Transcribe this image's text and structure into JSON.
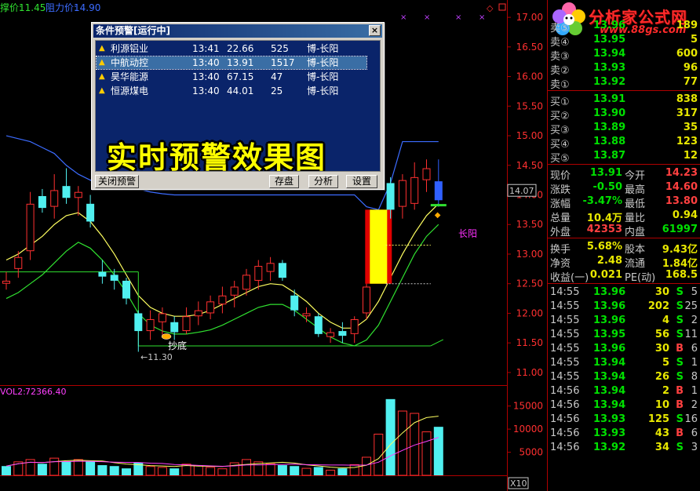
{
  "header": {
    "support_label": "撑价:",
    "support_value": "11.45",
    "resist_label": "阻力价:",
    "resist_value": "14.90"
  },
  "volume_header": {
    "label": "VOL2:",
    "value": "72366.40"
  },
  "volume_axis": [
    "15000",
    "10000",
    "5000"
  ],
  "zoom": "X10",
  "annotations": {
    "buy_bottom": "抄底",
    "low_marker": "←11.30",
    "long_yang": "长阳",
    "current_price_box": "14.07"
  },
  "price_axis": [
    "17.00",
    "16.50",
    "16.00",
    "15.50",
    "15.00",
    "14.50",
    "14.00",
    "13.50",
    "13.00",
    "12.50",
    "12.00",
    "11.50",
    "11.00"
  ],
  "dialog": {
    "title": "条件预警[运行中]",
    "close": "×",
    "rows": [
      {
        "name": "利源铝业",
        "time": "13:41",
        "price": "22.66",
        "vol": "525",
        "note": "博-长阳"
      },
      {
        "name": "中航动控",
        "time": "13:40",
        "price": "13.91",
        "vol": "1517",
        "note": "博-长阳"
      },
      {
        "name": "昊华能源",
        "time": "13:40",
        "price": "67.15",
        "vol": "47",
        "note": "博-长阳"
      },
      {
        "name": "恒源煤电",
        "time": "13:40",
        "price": "44.01",
        "vol": "25",
        "note": "博-长阳"
      }
    ],
    "banner": "实时预警效果图",
    "buttons": {
      "close_alert": "关闭预警",
      "save": "存盘",
      "analyze": "分析",
      "settings": "设置"
    }
  },
  "logo": {
    "name": "分析家公式网",
    "url": "www.88gs.com"
  },
  "orderbook": {
    "sells": [
      {
        "label": "卖⑤",
        "price": "13.96",
        "qty": "189"
      },
      {
        "label": "卖④",
        "price": "13.95",
        "qty": "5"
      },
      {
        "label": "卖③",
        "price": "13.94",
        "qty": "600"
      },
      {
        "label": "卖②",
        "price": "13.93",
        "qty": "96"
      },
      {
        "label": "卖①",
        "price": "13.92",
        "qty": "77"
      }
    ],
    "buys": [
      {
        "label": "买①",
        "price": "13.91",
        "qty": "838"
      },
      {
        "label": "买②",
        "price": "13.90",
        "qty": "317"
      },
      {
        "label": "买③",
        "price": "13.89",
        "qty": "35"
      },
      {
        "label": "买④",
        "price": "13.88",
        "qty": "123"
      },
      {
        "label": "买⑤",
        "price": "13.87",
        "qty": "12"
      }
    ]
  },
  "stats": [
    {
      "l1": "现价",
      "v1": "13.91",
      "c1": "green",
      "l2": "今开",
      "v2": "14.23",
      "c2": "red"
    },
    {
      "l1": "涨跌",
      "v1": "-0.50",
      "c1": "green",
      "l2": "最高",
      "v2": "14.60",
      "c2": "red"
    },
    {
      "l1": "涨幅",
      "v1": "-3.47%",
      "c1": "green",
      "l2": "最低",
      "v2": "13.80",
      "c2": "red"
    },
    {
      "l1": "总量",
      "v1": "10.4万",
      "c1": "yellow",
      "l2": "量比",
      "v2": "0.94",
      "c2": "yellow"
    },
    {
      "l1": "外盘",
      "v1": "42353",
      "c1": "red",
      "l2": "内盘",
      "v2": "61997",
      "c2": "green"
    }
  ],
  "stats2": [
    {
      "l1": "换手",
      "v1": "5.68%",
      "l2": "股本",
      "v2": "9.43亿"
    },
    {
      "l1": "净资",
      "v1": "2.48",
      "l2": "流通",
      "v2": "1.84亿"
    },
    {
      "l1": "收益(一)",
      "v1": "0.021",
      "l2": "PE(动)",
      "v2": "168.5"
    }
  ],
  "ticks": [
    {
      "time": "14:55",
      "price": "13.96",
      "vol": "30",
      "side": "S",
      "n": "5"
    },
    {
      "time": "14:55",
      "price": "13.96",
      "vol": "202",
      "side": "S",
      "n": "25"
    },
    {
      "time": "14:55",
      "price": "13.96",
      "vol": "4",
      "side": "S",
      "n": "2"
    },
    {
      "time": "14:55",
      "price": "13.95",
      "vol": "56",
      "side": "S",
      "n": "11"
    },
    {
      "time": "14:55",
      "price": "13.96",
      "vol": "30",
      "side": "B",
      "n": "6"
    },
    {
      "time": "14:55",
      "price": "13.94",
      "vol": "5",
      "side": "S",
      "n": "1"
    },
    {
      "time": "14:55",
      "price": "13.94",
      "vol": "26",
      "side": "S",
      "n": "8"
    },
    {
      "time": "14:56",
      "price": "13.94",
      "vol": "2",
      "side": "B",
      "n": "1"
    },
    {
      "time": "14:56",
      "price": "13.94",
      "vol": "10",
      "side": "B",
      "n": "2"
    },
    {
      "time": "14:56",
      "price": "13.93",
      "vol": "125",
      "side": "S",
      "n": "16"
    },
    {
      "time": "14:56",
      "price": "13.93",
      "vol": "43",
      "side": "B",
      "n": "6"
    },
    {
      "time": "14:56",
      "price": "13.92",
      "vol": "34",
      "side": "S",
      "n": "3"
    }
  ],
  "chart_data": {
    "type": "candlestick",
    "ylim": [
      10.8,
      17.2
    ],
    "candles": [
      {
        "o": 12.55,
        "h": 12.7,
        "l": 12.4,
        "c": 12.5,
        "color": "red"
      },
      {
        "o": 12.75,
        "h": 13.05,
        "l": 12.6,
        "c": 12.95,
        "color": "red"
      },
      {
        "o": 13.05,
        "h": 14.05,
        "l": 12.9,
        "c": 13.85,
        "color": "red"
      },
      {
        "o": 13.98,
        "h": 14.1,
        "l": 13.7,
        "c": 13.78,
        "color": "cyan"
      },
      {
        "o": 13.8,
        "h": 14.35,
        "l": 13.6,
        "c": 14.08,
        "color": "red"
      },
      {
        "o": 14.15,
        "h": 14.45,
        "l": 13.85,
        "c": 13.95,
        "color": "cyan"
      },
      {
        "o": 13.95,
        "h": 14.15,
        "l": 13.65,
        "c": 14.05,
        "color": "red"
      },
      {
        "o": 13.85,
        "h": 14.0,
        "l": 13.45,
        "c": 13.55,
        "color": "cyan"
      },
      {
        "o": 12.7,
        "h": 12.9,
        "l": 12.5,
        "c": 12.62,
        "color": "cyan"
      },
      {
        "o": 12.65,
        "h": 12.75,
        "l": 12.4,
        "c": 12.55,
        "color": "cyan"
      },
      {
        "o": 12.55,
        "h": 12.6,
        "l": 12.15,
        "c": 12.25,
        "color": "cyan"
      },
      {
        "o": 12.0,
        "h": 12.05,
        "l": 11.35,
        "c": 11.7,
        "color": "cyan"
      },
      {
        "o": 11.7,
        "h": 12.05,
        "l": 11.55,
        "c": 11.9,
        "color": "red"
      },
      {
        "o": 11.85,
        "h": 12.1,
        "l": 11.6,
        "c": 12.0,
        "color": "red"
      },
      {
        "o": 11.85,
        "h": 11.95,
        "l": 11.55,
        "c": 11.68,
        "color": "cyan"
      },
      {
        "o": 11.7,
        "h": 12.1,
        "l": 11.65,
        "c": 11.95,
        "color": "red"
      },
      {
        "o": 11.95,
        "h": 12.2,
        "l": 11.8,
        "c": 12.05,
        "color": "red"
      },
      {
        "o": 12.0,
        "h": 12.3,
        "l": 11.9,
        "c": 12.2,
        "color": "red"
      },
      {
        "o": 12.15,
        "h": 12.45,
        "l": 12.0,
        "c": 12.3,
        "color": "red"
      },
      {
        "o": 12.3,
        "h": 12.55,
        "l": 12.1,
        "c": 12.45,
        "color": "red"
      },
      {
        "o": 12.4,
        "h": 12.75,
        "l": 12.3,
        "c": 12.65,
        "color": "red"
      },
      {
        "o": 12.55,
        "h": 12.9,
        "l": 12.4,
        "c": 12.8,
        "color": "red"
      },
      {
        "o": 12.7,
        "h": 12.95,
        "l": 12.55,
        "c": 12.85,
        "color": "red"
      },
      {
        "o": 12.85,
        "h": 12.9,
        "l": 12.55,
        "c": 12.6,
        "color": "cyan"
      },
      {
        "o": 12.3,
        "h": 12.4,
        "l": 11.95,
        "c": 12.05,
        "color": "cyan"
      },
      {
        "o": 12.0,
        "h": 12.1,
        "l": 11.85,
        "c": 11.95,
        "color": "red"
      },
      {
        "o": 11.95,
        "h": 12.0,
        "l": 11.6,
        "c": 11.65,
        "color": "cyan"
      },
      {
        "o": 11.6,
        "h": 11.75,
        "l": 11.5,
        "c": 11.68,
        "color": "red"
      },
      {
        "o": 11.7,
        "h": 11.85,
        "l": 11.5,
        "c": 11.62,
        "color": "cyan"
      },
      {
        "o": 11.65,
        "h": 11.95,
        "l": 11.5,
        "c": 11.9,
        "color": "red"
      },
      {
        "o": 12.0,
        "h": 12.55,
        "l": 11.9,
        "c": 12.45,
        "color": "red"
      },
      {
        "o": 12.5,
        "h": 13.75,
        "l": 12.45,
        "c": 13.75,
        "color": "yellow-signal"
      },
      {
        "o": 13.75,
        "h": 14.3,
        "l": 13.6,
        "c": 14.2,
        "color": "cyan"
      },
      {
        "o": 13.8,
        "h": 14.35,
        "l": 13.6,
        "c": 14.25,
        "color": "red"
      },
      {
        "o": 13.85,
        "h": 14.55,
        "l": 13.75,
        "c": 14.3,
        "color": "red"
      },
      {
        "o": 14.25,
        "h": 14.6,
        "l": 14.05,
        "c": 14.45,
        "color": "red"
      },
      {
        "o": 14.23,
        "h": 14.6,
        "l": 13.8,
        "c": 13.91,
        "color": "blue"
      }
    ],
    "volume": [
      {
        "v": 2000,
        "color": "cyan"
      },
      {
        "v": 3000,
        "color": "red"
      },
      {
        "v": 3500,
        "color": "red"
      },
      {
        "v": 2500,
        "color": "cyan"
      },
      {
        "v": 3800,
        "color": "red"
      },
      {
        "v": 3000,
        "color": "cyan"
      },
      {
        "v": 3500,
        "color": "red"
      },
      {
        "v": 3000,
        "color": "cyan"
      },
      {
        "v": 2200,
        "color": "cyan"
      },
      {
        "v": 2000,
        "color": "cyan"
      },
      {
        "v": 1500,
        "color": "cyan"
      },
      {
        "v": 2800,
        "color": "cyan"
      },
      {
        "v": 2000,
        "color": "red"
      },
      {
        "v": 1800,
        "color": "red"
      },
      {
        "v": 1500,
        "color": "cyan"
      },
      {
        "v": 2500,
        "color": "red"
      },
      {
        "v": 2200,
        "color": "red"
      },
      {
        "v": 1800,
        "color": "red"
      },
      {
        "v": 1500,
        "color": "red"
      },
      {
        "v": 2800,
        "color": "red"
      },
      {
        "v": 3500,
        "color": "red"
      },
      {
        "v": 3000,
        "color": "red"
      },
      {
        "v": 2600,
        "color": "red"
      },
      {
        "v": 2200,
        "color": "cyan"
      },
      {
        "v": 2000,
        "color": "cyan"
      },
      {
        "v": 1600,
        "color": "red"
      },
      {
        "v": 1800,
        "color": "cyan"
      },
      {
        "v": 1200,
        "color": "red"
      },
      {
        "v": 1500,
        "color": "cyan"
      },
      {
        "v": 2400,
        "color": "red"
      },
      {
        "v": 4000,
        "color": "red"
      },
      {
        "v": 9000,
        "color": "red"
      },
      {
        "v": 16500,
        "color": "cyan"
      },
      {
        "v": 14000,
        "color": "red"
      },
      {
        "v": 13500,
        "color": "red"
      },
      {
        "v": 9500,
        "color": "red"
      },
      {
        "v": 10500,
        "color": "cyan"
      }
    ],
    "resistance_line": [
      [
        0,
        15.0
      ],
      [
        1,
        14.95
      ],
      [
        2,
        14.9
      ],
      [
        3,
        14.8
      ],
      [
        4,
        14.7
      ],
      [
        5,
        14.5
      ],
      [
        6,
        14.35
      ],
      [
        7,
        14.25
      ],
      [
        8,
        14.2
      ],
      [
        9,
        14.2
      ],
      [
        10,
        14.15
      ],
      [
        11,
        14.1
      ],
      [
        12,
        14.05
      ],
      [
        13,
        14.02
      ],
      [
        14,
        14.0
      ],
      [
        15,
        14.0
      ],
      [
        16,
        14.0
      ],
      [
        17,
        14.0
      ],
      [
        18,
        14.0
      ],
      [
        19,
        14.0
      ],
      [
        20,
        14.0
      ],
      [
        21,
        14.0
      ],
      [
        22,
        14.0
      ],
      [
        23,
        14.0
      ],
      [
        24,
        14.0
      ],
      [
        25,
        14.0
      ],
      [
        26,
        14.0
      ],
      [
        27,
        14.0
      ],
      [
        28,
        14.0
      ],
      [
        29,
        14.0
      ],
      [
        30,
        13.8
      ],
      [
        31,
        13.75
      ],
      [
        32,
        14.2
      ],
      [
        33,
        14.9
      ],
      [
        34,
        14.9
      ],
      [
        35,
        14.9
      ],
      [
        36,
        14.9
      ]
    ],
    "ma_yellow": [
      [
        0,
        12.9
      ],
      [
        1,
        13.0
      ],
      [
        2,
        13.15
      ],
      [
        3,
        13.3
      ],
      [
        4,
        13.5
      ],
      [
        5,
        13.65
      ],
      [
        6,
        13.7
      ],
      [
        7,
        13.55
      ],
      [
        8,
        13.3
      ],
      [
        9,
        13.0
      ],
      [
        10,
        12.65
      ],
      [
        11,
        12.3
      ],
      [
        12,
        12.1
      ],
      [
        13,
        12.0
      ],
      [
        14,
        11.95
      ],
      [
        15,
        11.95
      ],
      [
        16,
        11.98
      ],
      [
        17,
        12.05
      ],
      [
        18,
        12.15
      ],
      [
        19,
        12.25
      ],
      [
        20,
        12.35
      ],
      [
        21,
        12.45
      ],
      [
        22,
        12.5
      ],
      [
        23,
        12.48
      ],
      [
        24,
        12.35
      ],
      [
        25,
        12.2
      ],
      [
        26,
        12.0
      ],
      [
        27,
        11.85
      ],
      [
        28,
        11.75
      ],
      [
        29,
        11.75
      ],
      [
        30,
        11.9
      ],
      [
        31,
        12.2
      ],
      [
        32,
        12.6
      ],
      [
        33,
        13.0
      ],
      [
        34,
        13.35
      ],
      [
        35,
        13.65
      ],
      [
        36,
        13.85
      ]
    ],
    "ma_green": [
      [
        0,
        12.25
      ],
      [
        1,
        12.35
      ],
      [
        2,
        12.5
      ],
      [
        3,
        12.65
      ],
      [
        4,
        12.85
      ],
      [
        5,
        13.05
      ],
      [
        6,
        13.2
      ],
      [
        7,
        13.1
      ],
      [
        8,
        12.9
      ],
      [
        9,
        12.65
      ],
      [
        10,
        12.35
      ],
      [
        11,
        12.0
      ],
      [
        12,
        11.8
      ],
      [
        13,
        11.7
      ],
      [
        14,
        11.65
      ],
      [
        15,
        11.65
      ],
      [
        16,
        11.68
      ],
      [
        17,
        11.72
      ],
      [
        18,
        11.8
      ],
      [
        19,
        11.9
      ],
      [
        20,
        12.0
      ],
      [
        21,
        12.1
      ],
      [
        22,
        12.15
      ],
      [
        23,
        12.15
      ],
      [
        24,
        12.05
      ],
      [
        25,
        11.9
      ],
      [
        26,
        11.75
      ],
      [
        27,
        11.6
      ],
      [
        28,
        11.5
      ],
      [
        29,
        11.45
      ],
      [
        30,
        11.55
      ],
      [
        31,
        11.8
      ],
      [
        32,
        12.2
      ],
      [
        33,
        12.6
      ],
      [
        34,
        13.0
      ],
      [
        35,
        13.3
      ],
      [
        36,
        13.5
      ]
    ],
    "support_value": 11.45
  }
}
